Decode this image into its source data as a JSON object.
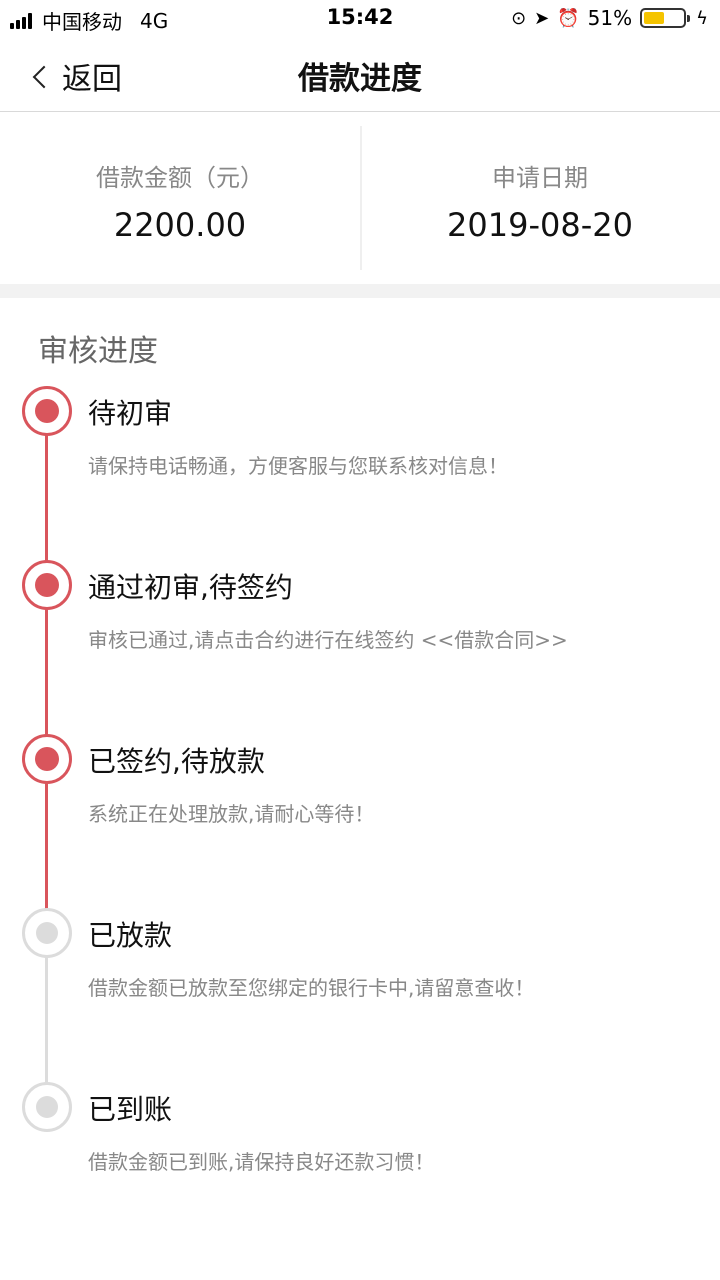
{
  "status_bar": {
    "carrier": "中国移动",
    "network": "4G",
    "time": "15:42",
    "battery_percent": "51%",
    "battery_level": 0.51,
    "icons": [
      "orientation-lock-icon",
      "location-icon",
      "alarm-icon",
      "battery-icon",
      "charging-icon"
    ]
  },
  "nav": {
    "back_label": "返回",
    "title": "借款进度"
  },
  "summary": {
    "amount_label": "借款金额（元）",
    "amount_value": "2200.00",
    "date_label": "申请日期",
    "date_value": "2019-08-20"
  },
  "progress": {
    "title": "审核进度",
    "steps": [
      {
        "title": "待初审",
        "desc": "请保持电话畅通，方便客服与您联系核对信息！",
        "status": "done"
      },
      {
        "title": "通过初审,待签约",
        "desc": "审核已通过,请点击合约进行在线签约 <<借款合同>>",
        "status": "done"
      },
      {
        "title": "已签约,待放款",
        "desc": "系统正在处理放款,请耐心等待！",
        "status": "done"
      },
      {
        "title": "已放款",
        "desc": "借款金额已放款至您绑定的银行卡中,请留意查收！",
        "status": "todo"
      },
      {
        "title": "已到账",
        "desc": "借款金额已到账,请保持良好还款习惯！",
        "status": "todo"
      }
    ]
  },
  "colors": {
    "accent": "#d9555c",
    "inactive": "#dcdcdc",
    "battery": "#f5c400"
  }
}
